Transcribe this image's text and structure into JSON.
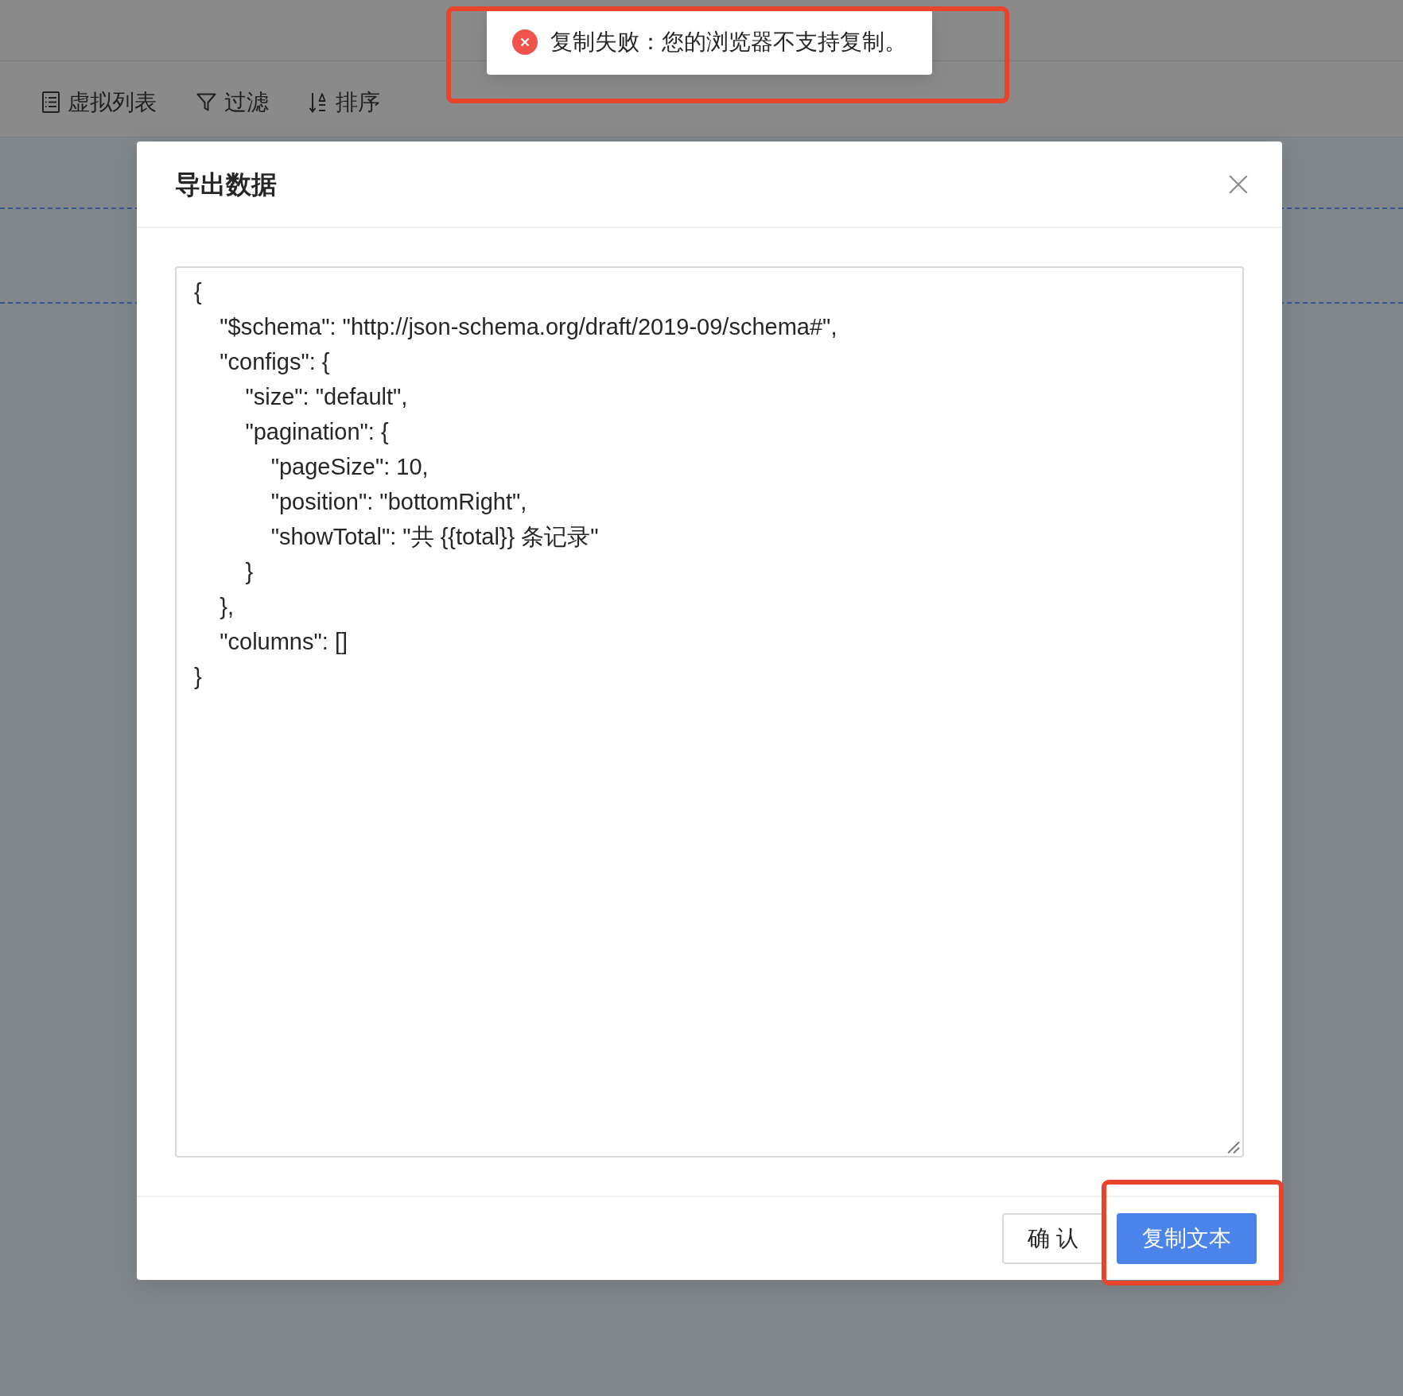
{
  "toast": {
    "kind": "error",
    "message": "复制失败：您的浏览器不支持复制。",
    "highlighted": true
  },
  "toolbar": {
    "items": [
      {
        "kind": "list",
        "label": "虚拟列表"
      },
      {
        "kind": "filter",
        "label": "过滤"
      },
      {
        "kind": "sort",
        "label": "排序"
      }
    ]
  },
  "modal": {
    "title": "导出数据",
    "textarea": {
      "value": "{\n    \"$schema\": \"http://json-schema.org/draft/2019-09/schema#\",\n    \"configs\": {\n        \"size\": \"default\",\n        \"pagination\": {\n            \"pageSize\": 10,\n            \"position\": \"bottomRight\",\n            \"showTotal\": \"共 {{total}} 条记录\"\n        }\n    },\n    \"columns\": []\n}"
    },
    "buttons": [
      {
        "kind": "default",
        "label": "确 认",
        "highlighted": false
      },
      {
        "kind": "primary",
        "label": "复制文本",
        "highlighted": true
      }
    ]
  }
}
